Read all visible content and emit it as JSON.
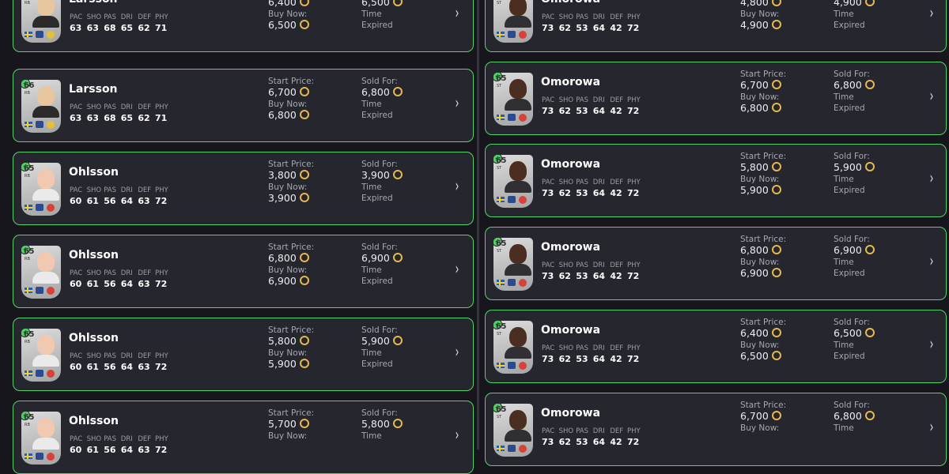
{
  "stat_labels": [
    "PAC",
    "SHO",
    "PAS",
    "DRI",
    "DEF",
    "PHY"
  ],
  "labels": {
    "start_price": "Start Price:",
    "buy_now": "Buy Now:",
    "sold_for": "Sold For:",
    "time": "Time"
  },
  "colors": {
    "row_border": "#55d36c",
    "row_bg": "#26262e",
    "page_bg": "#16161c",
    "coin": "#e6b94c"
  },
  "icons": {
    "coin": "coin-icon",
    "chevron": "chevron-right-icon",
    "check": "check-icon"
  },
  "left_rows": [
    {
      "player": {
        "name": "Larsson",
        "rating": "66",
        "position": "RB",
        "stats": [
          "63",
          "63",
          "68",
          "65",
          "62",
          "71"
        ]
      },
      "start_price": "6,400",
      "buy_now": "6,500",
      "sold_for": "6,500",
      "time_value": "Expired"
    },
    {
      "player": {
        "name": "Larsson",
        "rating": "66",
        "position": "RB",
        "stats": [
          "63",
          "63",
          "68",
          "65",
          "62",
          "71"
        ]
      },
      "start_price": "6,700",
      "buy_now": "6,800",
      "sold_for": "6,800",
      "time_value": "Expired"
    },
    {
      "player": {
        "name": "Ohlsson",
        "rating": "65",
        "position": "RB",
        "stats": [
          "60",
          "61",
          "56",
          "64",
          "63",
          "72"
        ]
      },
      "start_price": "3,800",
      "buy_now": "3,900",
      "sold_for": "3,900",
      "time_value": "Expired"
    },
    {
      "player": {
        "name": "Ohlsson",
        "rating": "65",
        "position": "RB",
        "stats": [
          "60",
          "61",
          "56",
          "64",
          "63",
          "72"
        ]
      },
      "start_price": "6,800",
      "buy_now": "6,900",
      "sold_for": "6,900",
      "time_value": "Expired"
    },
    {
      "player": {
        "name": "Ohlsson",
        "rating": "65",
        "position": "RB",
        "stats": [
          "60",
          "61",
          "56",
          "64",
          "63",
          "72"
        ]
      },
      "start_price": "5,800",
      "buy_now": "5,900",
      "sold_for": "5,900",
      "time_value": "Expired"
    },
    {
      "player": {
        "name": "Ohlsson",
        "rating": "65",
        "position": "RB",
        "stats": [
          "60",
          "61",
          "56",
          "64",
          "63",
          "72"
        ]
      },
      "start_price": "5,700",
      "buy_now": "",
      "sold_for": "5,800",
      "time_value": ""
    }
  ],
  "right_rows": [
    {
      "player": {
        "name": "Omorowa",
        "rating": "65",
        "position": "ST",
        "stats": [
          "73",
          "62",
          "53",
          "64",
          "42",
          "72"
        ]
      },
      "start_price": "4,800",
      "buy_now": "4,900",
      "sold_for": "4,900",
      "time_value": "Expired"
    },
    {
      "player": {
        "name": "Omorowa",
        "rating": "65",
        "position": "ST",
        "stats": [
          "73",
          "62",
          "53",
          "64",
          "42",
          "72"
        ]
      },
      "start_price": "6,700",
      "buy_now": "6,800",
      "sold_for": "6,800",
      "time_value": "Expired"
    },
    {
      "player": {
        "name": "Omorowa",
        "rating": "65",
        "position": "ST",
        "stats": [
          "73",
          "62",
          "53",
          "64",
          "42",
          "72"
        ]
      },
      "start_price": "5,800",
      "buy_now": "5,900",
      "sold_for": "5,900",
      "time_value": "Expired"
    },
    {
      "player": {
        "name": "Omorowa",
        "rating": "65",
        "position": "ST",
        "stats": [
          "73",
          "62",
          "53",
          "64",
          "42",
          "72"
        ]
      },
      "start_price": "6,800",
      "buy_now": "6,900",
      "sold_for": "6,900",
      "time_value": "Expired"
    },
    {
      "player": {
        "name": "Omorowa",
        "rating": "65",
        "position": "ST",
        "stats": [
          "73",
          "62",
          "53",
          "64",
          "42",
          "72"
        ]
      },
      "start_price": "6,400",
      "buy_now": "6,500",
      "sold_for": "6,500",
      "time_value": "Expired"
    },
    {
      "player": {
        "name": "Omorowa",
        "rating": "65",
        "position": "ST",
        "stats": [
          "73",
          "62",
          "53",
          "64",
          "42",
          "72"
        ]
      },
      "start_price": "6,700",
      "buy_now": "",
      "sold_for": "6,800",
      "time_value": ""
    }
  ]
}
